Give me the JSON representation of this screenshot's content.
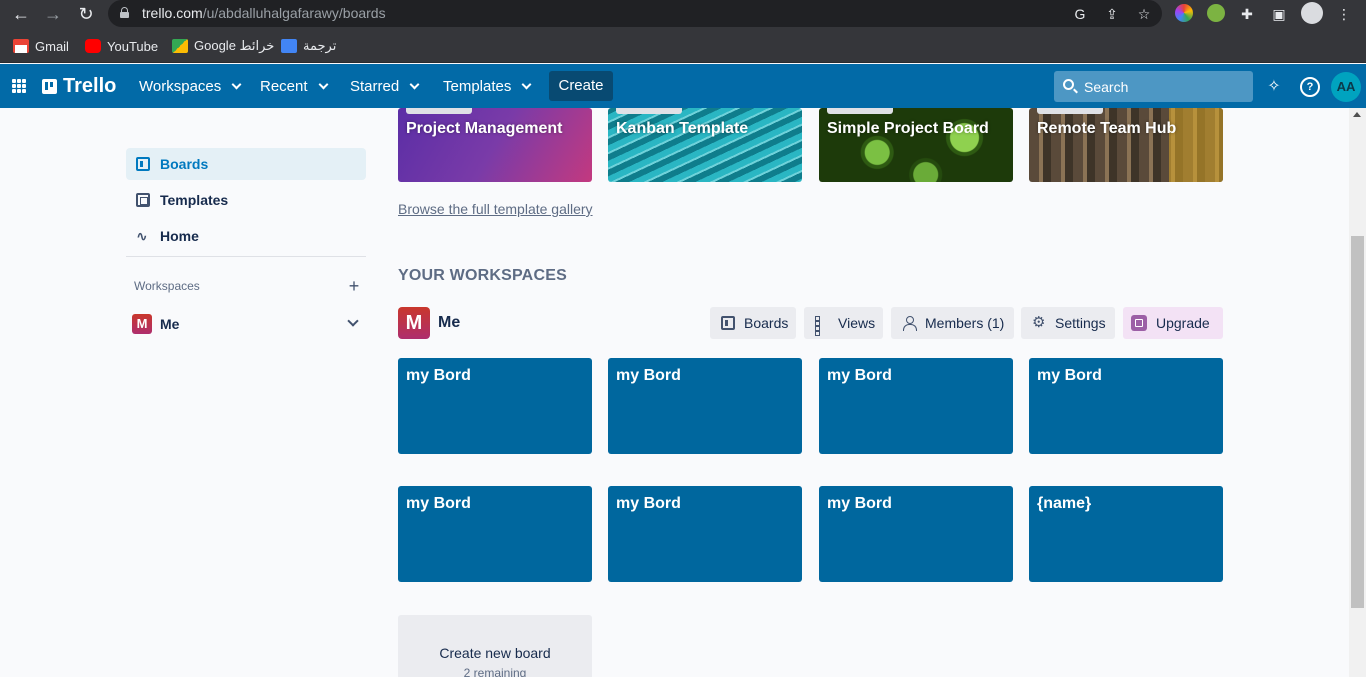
{
  "browser": {
    "url_host": "trello.com",
    "url_path": "/u/abdalluhalgafarawy/boards",
    "bookmarks": [
      {
        "label": "Gmail",
        "icon": "gmail-icon"
      },
      {
        "label": "YouTube",
        "icon": "youtube-icon"
      },
      {
        "label": "Google خرائط",
        "icon": "maps-icon"
      },
      {
        "label": "ترجمة",
        "icon": "translate-icon"
      }
    ]
  },
  "header": {
    "logo": "Trello",
    "nav": [
      {
        "label": "Workspaces"
      },
      {
        "label": "Recent"
      },
      {
        "label": "Starred"
      },
      {
        "label": "Templates"
      }
    ],
    "create_label": "Create",
    "search_placeholder": "Search",
    "avatar_initials": "AA",
    "brand_color": "#026aa7"
  },
  "sidebar": {
    "items": [
      {
        "label": "Boards",
        "icon": "board-icon",
        "active": true
      },
      {
        "label": "Templates",
        "icon": "template-icon",
        "active": false
      },
      {
        "label": "Home",
        "icon": "activity-icon",
        "active": false
      }
    ],
    "workspaces_label": "Workspaces",
    "workspace": {
      "initial": "M",
      "name": "Me"
    }
  },
  "templates": {
    "cards": [
      {
        "title": "Project Management"
      },
      {
        "title": "Kanban Template"
      },
      {
        "title": "Simple Project Board"
      },
      {
        "title": "Remote Team Hub"
      }
    ],
    "browse_link": "Browse the full template gallery"
  },
  "workspaces_section": {
    "heading": "YOUR WORKSPACES",
    "workspace_initial": "M",
    "workspace_name": "Me",
    "buttons": [
      {
        "label": "Boards",
        "icon": "board-icon"
      },
      {
        "label": "Views",
        "icon": "grid-icon"
      },
      {
        "label": "Members (1)",
        "icon": "person-icon"
      },
      {
        "label": "Settings",
        "icon": "gear-icon"
      },
      {
        "label": "Upgrade",
        "icon": "upgrade-icon"
      }
    ],
    "boards": [
      {
        "title": "my Bord"
      },
      {
        "title": "my Bord"
      },
      {
        "title": "my Bord"
      },
      {
        "title": "my Bord"
      },
      {
        "title": "my Bord"
      },
      {
        "title": "my Bord"
      },
      {
        "title": "my Bord"
      },
      {
        "title": "{name}"
      }
    ],
    "board_color": "#00679e",
    "create_board_label": "Create new board",
    "create_board_sub": "2 remaining"
  }
}
